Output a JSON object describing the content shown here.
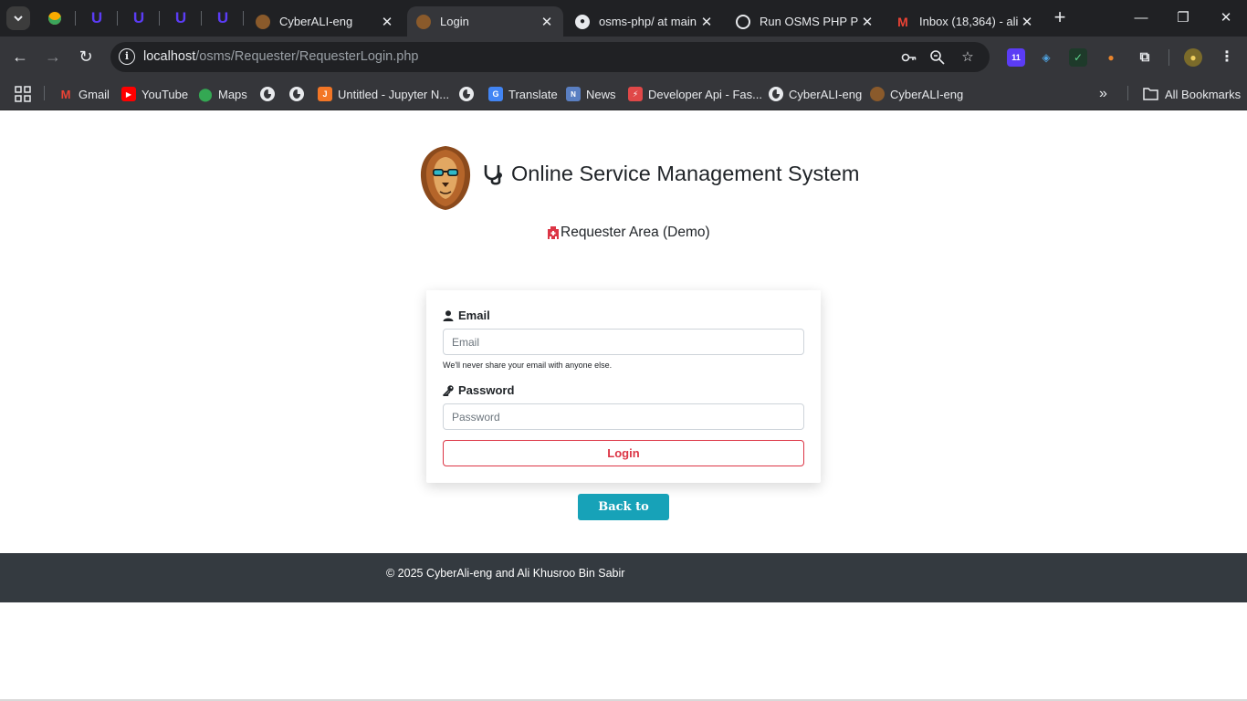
{
  "browser": {
    "tab_search_icon": "chevron-down-icon",
    "pinned_tabs": [
      {
        "name": "pinned-tab-colab",
        "glyph": "●",
        "color": "#f9ab00"
      },
      {
        "name": "pinned-tab-udemy-1",
        "glyph": "U",
        "color": "#5b3cf5"
      },
      {
        "name": "pinned-tab-udemy-2",
        "glyph": "U",
        "color": "#5b3cf5"
      },
      {
        "name": "pinned-tab-udemy-3",
        "glyph": "U",
        "color": "#5b3cf5"
      },
      {
        "name": "pinned-tab-udemy-4",
        "glyph": "U",
        "color": "#5b3cf5"
      }
    ],
    "tabs": [
      {
        "title": "CyberALI-eng",
        "active": false,
        "close": "✕"
      },
      {
        "title": "Login",
        "active": true,
        "close": "✕"
      },
      {
        "title": "osms-php/ at main",
        "active": false,
        "close": "✕"
      },
      {
        "title": "Run OSMS PHP Pro",
        "active": false,
        "close": "✕"
      },
      {
        "title": "Inbox (18,364) - ali",
        "active": false,
        "close": "✕"
      }
    ],
    "new_tab": "+",
    "window_controls": {
      "minimize": "—",
      "maximize": "❐",
      "close": "✕"
    },
    "toolbar": {
      "back": "←",
      "forward": "→",
      "reload": "↻",
      "url_host": "localhost",
      "url_path": "/osms/Requester/RequesterLogin.php",
      "extension_badge": "11"
    },
    "bookmarks": [
      {
        "label": "Gmail",
        "icon": "gmail-icon"
      },
      {
        "label": "YouTube",
        "icon": "youtube-icon"
      },
      {
        "label": "Maps",
        "icon": "maps-icon"
      },
      {
        "label": "",
        "icon": "globe-icon"
      },
      {
        "label": "",
        "icon": "globe-icon"
      },
      {
        "label": "Untitled - Jupyter N...",
        "icon": "jupyter-icon"
      },
      {
        "label": "",
        "icon": "globe-icon"
      },
      {
        "label": "Translate",
        "icon": "translate-icon"
      },
      {
        "label": "News",
        "icon": "news-icon"
      },
      {
        "label": "Developer Api - Fas...",
        "icon": "fastapi-icon"
      },
      {
        "label": "CyberALI-eng",
        "icon": "globe-icon"
      },
      {
        "label": "CyberALI-eng",
        "icon": "lion-icon"
      }
    ],
    "bookmarks_overflow": "»",
    "all_bookmarks": "All Bookmarks"
  },
  "page": {
    "site_title": "Online Service Management System",
    "area_title": "Requester Area (Demo)",
    "form": {
      "email_label": "Email",
      "email_placeholder": "Email",
      "email_help": "We'll never share your email with anyone else.",
      "password_label": "Password",
      "password_placeholder": "Password",
      "login_label": "Login"
    },
    "back_home_label": "Back to Home",
    "footer_text": "© 2025 CyberAli-eng and Ali Khusroo Bin Sabir"
  },
  "colors": {
    "browser_dark": "#202124",
    "toolbar": "#35363a",
    "danger": "#dc3545",
    "info": "#17a2b8",
    "footer": "#343a40"
  }
}
